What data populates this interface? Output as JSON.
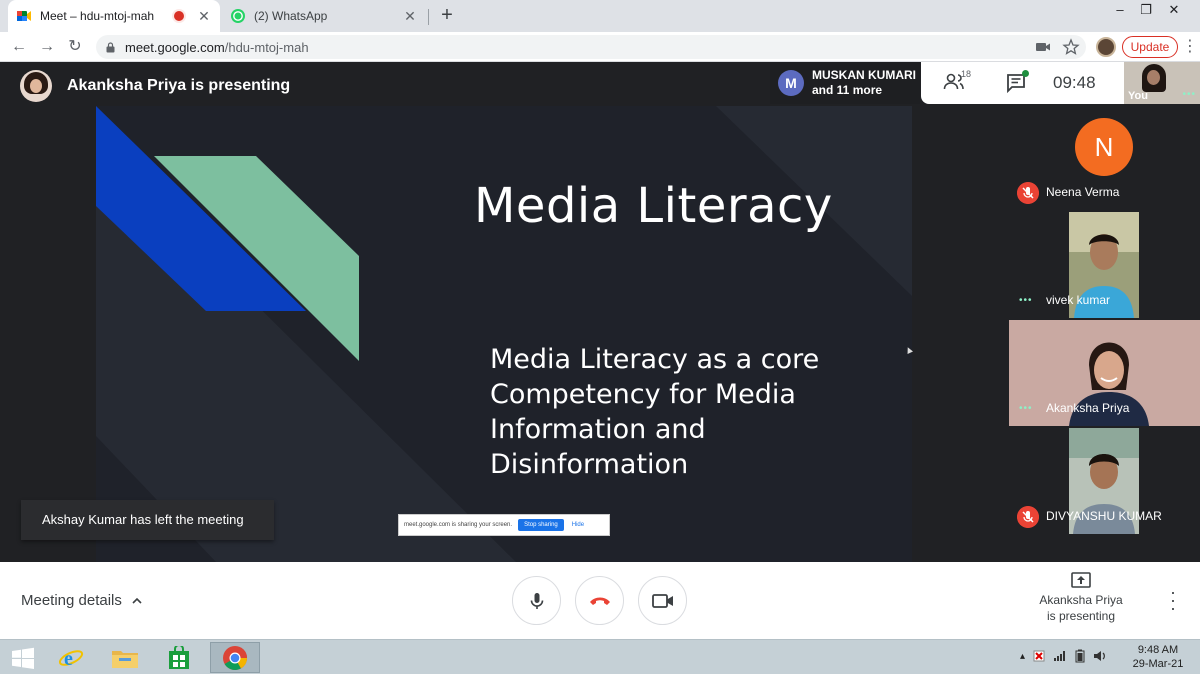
{
  "browser": {
    "tabs": [
      {
        "title": "Meet – hdu-mtoj-mah",
        "active": true,
        "recording": true
      },
      {
        "title": "(2) WhatsApp",
        "active": false
      }
    ],
    "window_controls": {
      "minimize": "–",
      "restore": "❐",
      "close": "✕"
    },
    "url_domain": "meet.google.com",
    "url_path": "/hdu-mtoj-mah",
    "update_label": "Update"
  },
  "meet": {
    "presenter_text": "Akanksha Priya is presenting",
    "participants_pill": {
      "avatar_letter": "M",
      "line1": "MUSKAN KUMARI",
      "line2": "and 11 more"
    },
    "participant_count": "18",
    "time": "09:48",
    "self_label": "You",
    "toast": "Akshay Kumar has left the meeting",
    "share_banner": {
      "text": "meet.google.com is sharing your screen.",
      "stop": "Stop sharing",
      "hide": "Hide"
    },
    "slide": {
      "title": "Media Literacy",
      "subtitle_lines": [
        "Media Literacy as a core",
        "Competency for Media",
        "Information and",
        "Disinformation"
      ],
      "colors": {
        "blue": "#0a3fbf",
        "green": "#7dbf9f",
        "background": "#1f222a"
      }
    },
    "tiles": [
      {
        "name": "Neena Verma",
        "avatar_letter": "N",
        "muted": true
      },
      {
        "name": "vivek kumar",
        "muted": false
      },
      {
        "name": "Akanksha Priya",
        "muted": false
      },
      {
        "name": "DIVYANSHU KUMAR",
        "muted": true
      }
    ],
    "bottom": {
      "meeting_details": "Meeting details",
      "present_line1": "Akanksha Priya",
      "present_line2": "is presenting"
    }
  },
  "taskbar": {
    "time": "9:48 AM",
    "date": "29-Mar-21"
  }
}
